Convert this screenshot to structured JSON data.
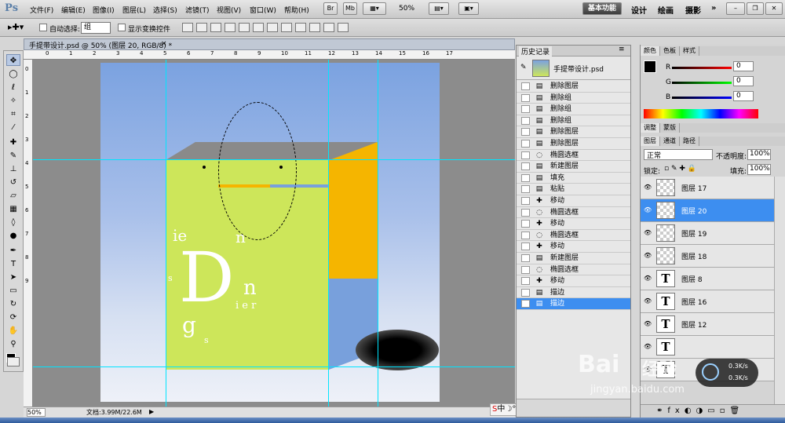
{
  "app": {
    "logo": "Ps"
  },
  "menu": {
    "items": [
      "文件(F)",
      "编辑(E)",
      "图像(I)",
      "图层(L)",
      "选择(S)",
      "滤镜(T)",
      "视图(V)",
      "窗口(W)",
      "帮助(H)"
    ],
    "buttons": [
      "Br",
      "Mb"
    ],
    "zoom": "50%",
    "workspaces": [
      "基本功能",
      "设计",
      "绘画",
      "摄影"
    ],
    "more": "»"
  },
  "options": {
    "auto_select_label": "自动选择:",
    "auto_select_value": "组",
    "show_transform_label": "显示变换控件"
  },
  "document": {
    "tab_title": "手提带设计.psd @ 50% (图层 20, RGB/8) *",
    "close": "×",
    "ruler_h": [
      "0",
      "1",
      "2",
      "3",
      "4",
      "5",
      "6",
      "7",
      "8",
      "9",
      "10",
      "11",
      "12",
      "13",
      "14",
      "15",
      "16",
      "17"
    ],
    "ruler_v": [
      "0",
      "1",
      "2",
      "3",
      "4",
      "5",
      "6",
      "7",
      "8",
      "9"
    ]
  },
  "canvas": {
    "letters": {
      "ie": "ie",
      "n_top": "n",
      "big_D": "D",
      "s_left": "s",
      "n_right": "n",
      "ier": "i e r",
      "g": "g",
      "s_small": "s"
    }
  },
  "status": {
    "zoom": "50%",
    "doc": "文档:3.99M/22.6M"
  },
  "history": {
    "tab": "历史记录",
    "snapshot": "手提带设计.psd",
    "steps": [
      "删除图层",
      "删除组",
      "删除组",
      "删除组",
      "删除图层",
      "删除图层",
      "椭圆选框",
      "新建图层",
      "填充",
      "粘贴",
      "移动",
      "椭圆选框",
      "移动",
      "椭圆选框",
      "移动",
      "新建图层",
      "椭圆选框",
      "移动",
      "描边",
      "描边"
    ],
    "selected_index": 19
  },
  "color": {
    "tabs": [
      "颜色",
      "色板",
      "样式"
    ],
    "r_label": "R",
    "g_label": "G",
    "b_label": "B",
    "r": "0",
    "g": "0",
    "b": "0",
    "fg": "#000000",
    "bg": "#0000ff"
  },
  "adjust": {
    "tabs": [
      "调整",
      "蒙版"
    ]
  },
  "layers": {
    "tabs": [
      "图层",
      "通道",
      "路径"
    ],
    "blend": "正常",
    "opacity_label": "不透明度:",
    "opacity": "100%",
    "lock_label": "锁定:",
    "fill_label": "填充:",
    "fill": "100%",
    "items": [
      {
        "name": "图层 17",
        "kind": "raster",
        "thumb": ""
      },
      {
        "name": "图层 20",
        "kind": "raster",
        "thumb": ""
      },
      {
        "name": "图层 19",
        "kind": "raster",
        "thumb": ""
      },
      {
        "name": "图层 18",
        "kind": "raster",
        "thumb": ""
      },
      {
        "name": "图层 8",
        "kind": "text",
        "thumb": "T"
      },
      {
        "name": "图层 16",
        "kind": "text",
        "thumb": "T"
      },
      {
        "name": "图层 12",
        "kind": "text",
        "thumb": "T"
      },
      {
        "name": "",
        "kind": "text",
        "thumb": "T"
      },
      {
        "name": "",
        "kind": "text",
        "thumb": "T"
      }
    ],
    "selected_index": 1
  },
  "watermark": {
    "brand": "Bai",
    "brand2": "经验",
    "url": "jingyan.baidu.com"
  },
  "netmeter": {
    "up": "0.3K/s",
    "down": "0.3K/s"
  }
}
